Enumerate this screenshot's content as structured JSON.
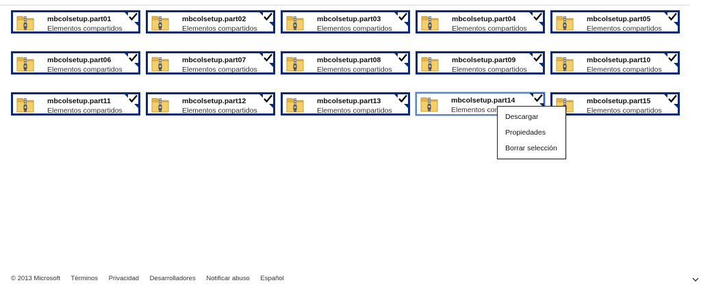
{
  "colors": {
    "tile_border": "#0a2a73",
    "focused_border": "#5b86c8",
    "menu_border": "#222222"
  },
  "files": [
    {
      "name": "mbcolsetup.part01",
      "location": "Elementos compartidos",
      "checked": true
    },
    {
      "name": "mbcolsetup.part02",
      "location": "Elementos compartidos",
      "checked": true
    },
    {
      "name": "mbcolsetup.part03",
      "location": "Elementos compartidos",
      "checked": true
    },
    {
      "name": "mbcolsetup.part04",
      "location": "Elementos compartidos",
      "checked": true
    },
    {
      "name": "mbcolsetup.part05",
      "location": "Elementos compartidos",
      "checked": true
    },
    {
      "name": "mbcolsetup.part06",
      "location": "Elementos compartidos",
      "checked": true
    },
    {
      "name": "mbcolsetup.part07",
      "location": "Elementos compartidos",
      "checked": true
    },
    {
      "name": "mbcolsetup.part08",
      "location": "Elementos compartidos",
      "checked": true
    },
    {
      "name": "mbcolsetup.part09",
      "location": "Elementos compartidos",
      "checked": true
    },
    {
      "name": "mbcolsetup.part10",
      "location": "Elementos compartidos",
      "checked": true
    },
    {
      "name": "mbcolsetup.part11",
      "location": "Elementos compartidos",
      "checked": true
    },
    {
      "name": "mbcolsetup.part12",
      "location": "Elementos compartidos",
      "checked": true
    },
    {
      "name": "mbcolsetup.part13",
      "location": "Elementos compartidos",
      "checked": true
    },
    {
      "name": "mbcolsetup.part14",
      "location": "Elementos compartidos",
      "checked": true,
      "focused": true
    },
    {
      "name": "mbcolsetup.part15",
      "location": "Elementos compartidos",
      "checked": true
    }
  ],
  "icons": {
    "file": "zip-folder-icon",
    "check": "checkmark-icon",
    "scroll": "chevron-down-icon"
  },
  "context_menu": {
    "items": [
      "Descargar",
      "Propiedades",
      "Borrar selección"
    ]
  },
  "footer": {
    "copyright": "© 2013 Microsoft",
    "links": [
      "Términos",
      "Privacidad",
      "Desarrolladores",
      "Notificar abuso",
      "Español"
    ]
  }
}
